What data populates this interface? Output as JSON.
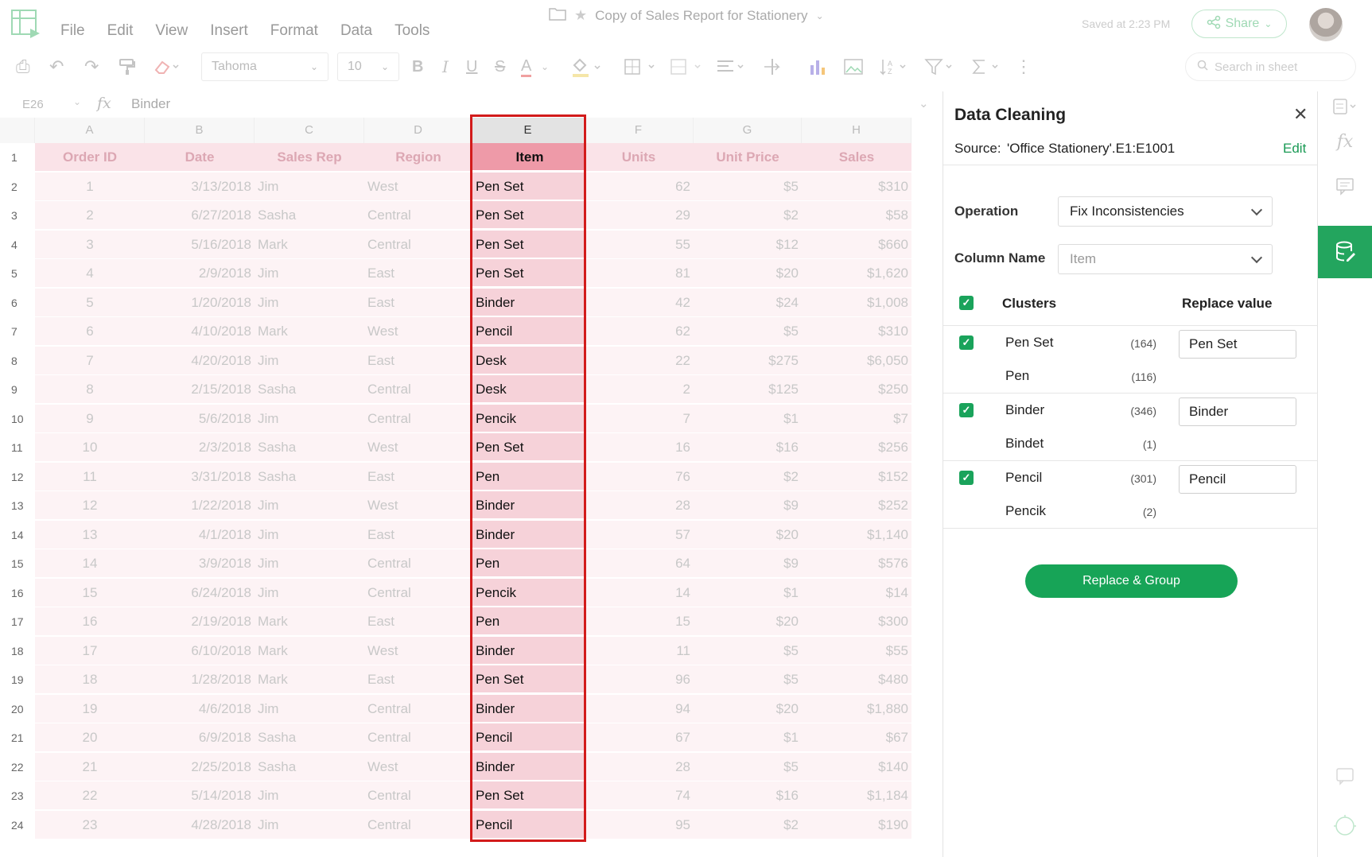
{
  "menus": [
    "File",
    "Edit",
    "View",
    "Insert",
    "Format",
    "Data",
    "Tools"
  ],
  "doc_title": "Copy of Sales Report for Stationery",
  "saved_text": "Saved at 2:23 PM",
  "share_label": "Share",
  "toolbar": {
    "font": "Tahoma",
    "font_size": "10",
    "search_placeholder": "Search in sheet",
    "bold": "B",
    "italic": "I",
    "underline": "U",
    "strike": "S",
    "text_color": "A"
  },
  "formula_bar": {
    "cell_ref": "E26",
    "fx": "fx",
    "value": "Binder"
  },
  "columns": [
    "A",
    "B",
    "C",
    "D",
    "E",
    "F",
    "G",
    "H"
  ],
  "rows": [
    {
      "n": "1",
      "a": "Order ID",
      "b": "Date",
      "c": "Sales Rep",
      "d": "Region",
      "e": "Item",
      "f": "Units",
      "g": "Unit Price",
      "h": "Sales"
    },
    {
      "n": "2",
      "a": "1",
      "b": "3/13/2018",
      "c": "Jim",
      "d": "West",
      "e": "Pen Set",
      "f": "62",
      "g": "$5",
      "h": "$310"
    },
    {
      "n": "3",
      "a": "2",
      "b": "6/27/2018",
      "c": "Sasha",
      "d": "Central",
      "e": "Pen Set",
      "f": "29",
      "g": "$2",
      "h": "$58"
    },
    {
      "n": "4",
      "a": "3",
      "b": "5/16/2018",
      "c": "Mark",
      "d": "Central",
      "e": "Pen Set",
      "f": "55",
      "g": "$12",
      "h": "$660"
    },
    {
      "n": "5",
      "a": "4",
      "b": "2/9/2018",
      "c": "Jim",
      "d": "East",
      "e": "Pen Set",
      "f": "81",
      "g": "$20",
      "h": "$1,620"
    },
    {
      "n": "6",
      "a": "5",
      "b": "1/20/2018",
      "c": "Jim",
      "d": "East",
      "e": "Binder",
      "f": "42",
      "g": "$24",
      "h": "$1,008"
    },
    {
      "n": "7",
      "a": "6",
      "b": "4/10/2018",
      "c": "Mark",
      "d": "West",
      "e": "Pencil",
      "f": "62",
      "g": "$5",
      "h": "$310"
    },
    {
      "n": "8",
      "a": "7",
      "b": "4/20/2018",
      "c": "Jim",
      "d": "East",
      "e": "Desk",
      "f": "22",
      "g": "$275",
      "h": "$6,050"
    },
    {
      "n": "9",
      "a": "8",
      "b": "2/15/2018",
      "c": "Sasha",
      "d": "Central",
      "e": "Desk",
      "f": "2",
      "g": "$125",
      "h": "$250"
    },
    {
      "n": "10",
      "a": "9",
      "b": "5/6/2018",
      "c": "Jim",
      "d": "Central",
      "e": "Pencik",
      "f": "7",
      "g": "$1",
      "h": "$7"
    },
    {
      "n": "11",
      "a": "10",
      "b": "2/3/2018",
      "c": "Sasha",
      "d": "West",
      "e": "Pen Set",
      "f": "16",
      "g": "$16",
      "h": "$256"
    },
    {
      "n": "12",
      "a": "11",
      "b": "3/31/2018",
      "c": "Sasha",
      "d": "East",
      "e": "Pen",
      "f": "76",
      "g": "$2",
      "h": "$152"
    },
    {
      "n": "13",
      "a": "12",
      "b": "1/22/2018",
      "c": "Jim",
      "d": "West",
      "e": "Binder",
      "f": "28",
      "g": "$9",
      "h": "$252"
    },
    {
      "n": "14",
      "a": "13",
      "b": "4/1/2018",
      "c": "Jim",
      "d": "East",
      "e": "Binder",
      "f": "57",
      "g": "$20",
      "h": "$1,140"
    },
    {
      "n": "15",
      "a": "14",
      "b": "3/9/2018",
      "c": "Jim",
      "d": "Central",
      "e": "Pen",
      "f": "64",
      "g": "$9",
      "h": "$576"
    },
    {
      "n": "16",
      "a": "15",
      "b": "6/24/2018",
      "c": "Jim",
      "d": "Central",
      "e": "Pencik",
      "f": "14",
      "g": "$1",
      "h": "$14"
    },
    {
      "n": "17",
      "a": "16",
      "b": "2/19/2018",
      "c": "Mark",
      "d": "East",
      "e": "Pen",
      "f": "15",
      "g": "$20",
      "h": "$300"
    },
    {
      "n": "18",
      "a": "17",
      "b": "6/10/2018",
      "c": "Mark",
      "d": "West",
      "e": "Binder",
      "f": "11",
      "g": "$5",
      "h": "$55"
    },
    {
      "n": "19",
      "a": "18",
      "b": "1/28/2018",
      "c": "Mark",
      "d": "East",
      "e": "Pen Set",
      "f": "96",
      "g": "$5",
      "h": "$480"
    },
    {
      "n": "20",
      "a": "19",
      "b": "4/6/2018",
      "c": "Jim",
      "d": "Central",
      "e": "Binder",
      "f": "94",
      "g": "$20",
      "h": "$1,880"
    },
    {
      "n": "21",
      "a": "20",
      "b": "6/9/2018",
      "c": "Sasha",
      "d": "Central",
      "e": "Pencil",
      "f": "67",
      "g": "$1",
      "h": "$67"
    },
    {
      "n": "22",
      "a": "21",
      "b": "2/25/2018",
      "c": "Sasha",
      "d": "West",
      "e": "Binder",
      "f": "28",
      "g": "$5",
      "h": "$140"
    },
    {
      "n": "23",
      "a": "22",
      "b": "5/14/2018",
      "c": "Jim",
      "d": "Central",
      "e": "Pen Set",
      "f": "74",
      "g": "$16",
      "h": "$1,184"
    },
    {
      "n": "24",
      "a": "23",
      "b": "4/28/2018",
      "c": "Jim",
      "d": "Central",
      "e": "Pencil",
      "f": "95",
      "g": "$2",
      "h": "$190"
    }
  ],
  "panel": {
    "title": "Data Cleaning",
    "source_label": "Source:",
    "source_value": "'Office Stationery'.E1:E1001",
    "edit_label": "Edit",
    "operation_label": "Operation",
    "operation_value": "Fix Inconsistencies",
    "column_name_label": "Column Name",
    "column_name_value": "Item",
    "clusters_header": "Clusters",
    "replace_header": "Replace value",
    "clusters": [
      {
        "items": [
          {
            "name": "Pen Set",
            "count": "(164)"
          },
          {
            "name": "Pen",
            "count": "(116)"
          }
        ],
        "replace": "Pen Set"
      },
      {
        "items": [
          {
            "name": "Binder",
            "count": "(346)"
          },
          {
            "name": "Bindet",
            "count": "(1)"
          }
        ],
        "replace": "Binder"
      },
      {
        "items": [
          {
            "name": "Pencil",
            "count": "(301)"
          },
          {
            "name": "Pencik",
            "count": "(2)"
          }
        ],
        "replace": "Pencil"
      }
    ],
    "button_label": "Replace & Group"
  },
  "colors": {
    "accent": "#17a457",
    "selection": "#d21b1b"
  }
}
